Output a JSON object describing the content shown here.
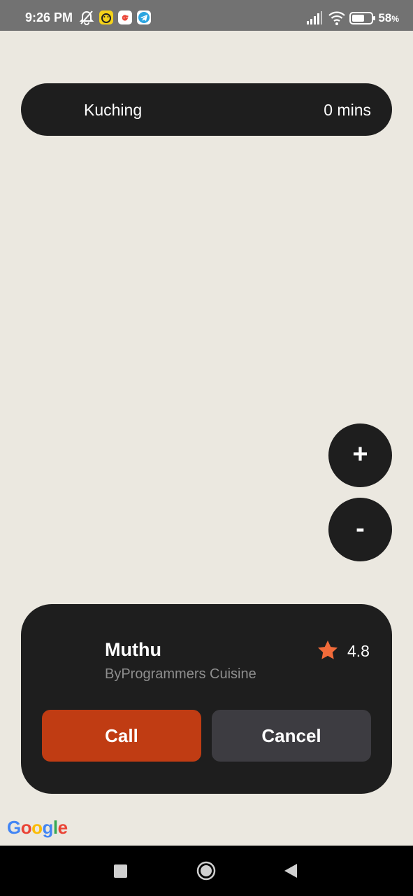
{
  "status_bar": {
    "time": "9:26 PM",
    "battery": "58",
    "battery_unit": "%",
    "icons": [
      "alarm-off-icon",
      "emoji-app-icon",
      "google-app-icon",
      "telegram-icon",
      "signal-icon",
      "wifi-icon",
      "battery-icon"
    ]
  },
  "route": {
    "location": "Kuching",
    "eta": "0 mins"
  },
  "zoom": {
    "in_label": "+",
    "out_label": "-"
  },
  "driver": {
    "name": "Muthu",
    "subtitle": "ByProgrammers Cuisine",
    "rating": "4.8",
    "star_color": "#f26b3a"
  },
  "actions": {
    "call_label": "Call",
    "cancel_label": "Cancel",
    "call_color": "#c03c13"
  },
  "map": {
    "attribution": [
      "G",
      "o",
      "o",
      "g",
      "l",
      "e"
    ]
  },
  "nav": {
    "icons": [
      "recents-square-icon",
      "home-circle-icon",
      "back-triangle-icon"
    ]
  }
}
